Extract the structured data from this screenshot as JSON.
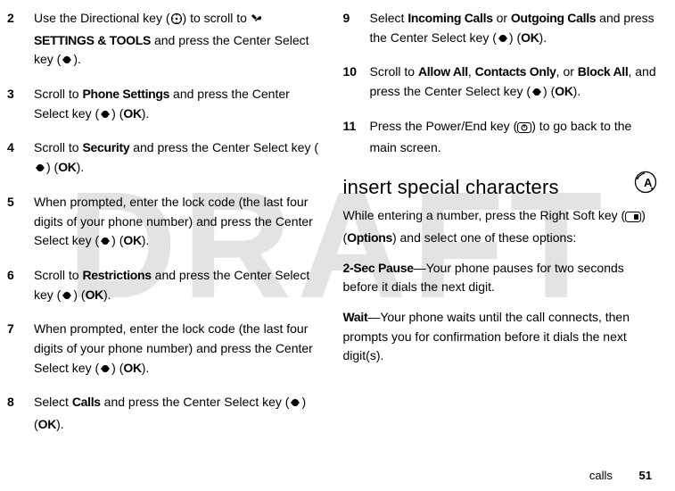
{
  "watermark": "DRAFT",
  "left_steps": [
    {
      "n": "2",
      "parts": [
        "Use the Directional key (",
        {
          "icon": "nav"
        },
        ") to scroll to ",
        {
          "icon": "tools"
        },
        " ",
        {
          "cb": "SETTINGS & TOOLS"
        },
        " and press the Center Select key (",
        {
          "icon": "center"
        },
        ")."
      ]
    },
    {
      "n": "3",
      "parts": [
        "Scroll to ",
        {
          "cb": "Phone Settings"
        },
        " and press the Center Select key (",
        {
          "icon": "center"
        },
        ") (",
        {
          "cb": "OK"
        },
        ")."
      ]
    },
    {
      "n": "4",
      "parts": [
        "Scroll to ",
        {
          "cb": "Security"
        },
        " and press the Center Select key (",
        {
          "icon": "center"
        },
        ") (",
        {
          "cb": "OK"
        },
        ")."
      ]
    },
    {
      "n": "5",
      "parts": [
        "When prompted, enter the lock code (the last four digits of your phone number) and press the Center Select key (",
        {
          "icon": "center"
        },
        ") (",
        {
          "cb": "OK"
        },
        ")."
      ]
    },
    {
      "n": "6",
      "parts": [
        "Scroll to ",
        {
          "cb": "Restrictions"
        },
        " and press the Center Select key (",
        {
          "icon": "center"
        },
        ") (",
        {
          "cb": "OK"
        },
        ")."
      ]
    },
    {
      "n": "7",
      "parts": [
        "When prompted, enter the lock code (the last four digits of your phone number) and press the Center Select key (",
        {
          "icon": "center"
        },
        ") (",
        {
          "cb": "OK"
        },
        ")."
      ]
    },
    {
      "n": "8",
      "parts": [
        "Select ",
        {
          "cb": "Calls"
        },
        " and press the Center Select key (",
        {
          "icon": "center"
        },
        ") (",
        {
          "cb": "OK"
        },
        ")."
      ]
    }
  ],
  "right_steps": [
    {
      "n": "9",
      "parts": [
        "Select ",
        {
          "cb": "Incoming Calls"
        },
        " or ",
        {
          "cb": "Outgoing Calls"
        },
        " and press the Center Select key (",
        {
          "icon": "center"
        },
        ") (",
        {
          "cb": "OK"
        },
        ")."
      ]
    },
    {
      "n": "10",
      "parts": [
        "Scroll to ",
        {
          "cb": "Allow All"
        },
        ", ",
        {
          "cb": "Contacts Only"
        },
        ", or ",
        {
          "cb": "Block All"
        },
        ", and press the Center Select key (",
        {
          "icon": "center"
        },
        ") (",
        {
          "cb": "OK"
        },
        ")."
      ]
    },
    {
      "n": "11",
      "parts": [
        "Press the Power/End key (",
        {
          "icon": "power"
        },
        ") to go back to the main screen."
      ]
    }
  ],
  "section_title": "insert special characters",
  "section_intro_parts": [
    "While entering a number, press the Right Soft key (",
    {
      "icon": "soft"
    },
    ") (",
    {
      "cb": "Options"
    },
    ") and select one of these options:"
  ],
  "option1_parts": [
    {
      "cb": "2-Sec Pause"
    },
    "—Your phone pauses for two seconds before it dials the next digit."
  ],
  "option2_parts": [
    {
      "cb": "Wait"
    },
    "—Your phone waits until the call connects, then prompts you for confirmation before it dials the next digit(s)."
  ],
  "footer_label": "calls",
  "page_number": "51"
}
